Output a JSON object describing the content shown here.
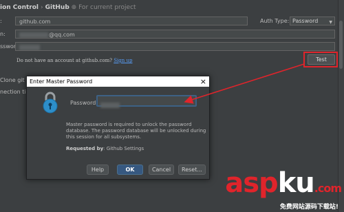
{
  "header": {
    "section": "ion Control",
    "separator": "›",
    "page": "GitHub",
    "scope_icon": "project-scope-icon",
    "scope_label": "For current project"
  },
  "form": {
    "host_label": ":",
    "host_value": "github.com",
    "auth_type_label": "Auth Type:",
    "auth_type_value": "Password",
    "login_label": "n:",
    "login_value": "@qq.com",
    "password_label": "ssword:",
    "signup_hint": "Do not have an account at github.com?",
    "signup_link": "Sign up",
    "test_button": "Test",
    "clone_label": "Clone git re",
    "timeout_label": "nection time"
  },
  "dialog": {
    "title": "Enter Master Password",
    "close_label": "×",
    "password_label": "Password",
    "description": "Master password is required to unlock the password database. The password database will be unlocked during this session for all subsystems.",
    "requested_by_label": "Requested by",
    "requested_by_value": "Github Settings",
    "buttons": {
      "help": "Help",
      "ok": "OK",
      "cancel": "Cancel",
      "reset": "Reset..."
    }
  },
  "watermark": {
    "main_red": "asp",
    "main_white": "ku",
    "domain_suffix": ".com",
    "subtitle": "免费网站源码下载站!"
  },
  "colors": {
    "background": "#3c3f41",
    "arrow": "#e0242b",
    "link": "#589df6",
    "ok_button": "#365880"
  }
}
